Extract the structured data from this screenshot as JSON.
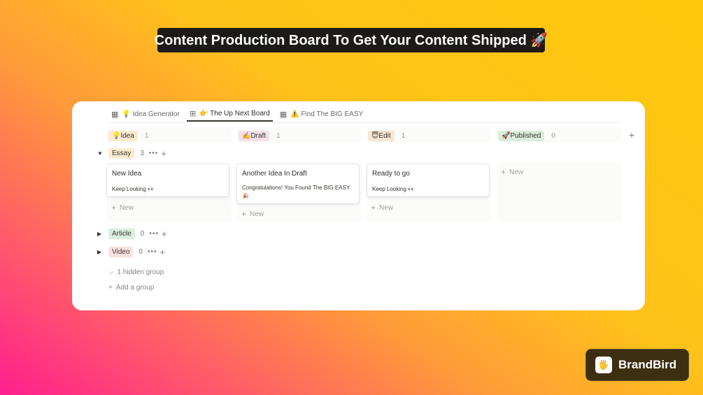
{
  "banner": {
    "title": "Content Production Board To Get Your Content Shipped 🚀"
  },
  "tabs": [
    {
      "icon": "▦",
      "label": "💡 Idea Generator"
    },
    {
      "icon": "⊞",
      "label": "👉 The Up Next Board"
    },
    {
      "icon": "▦",
      "label": "⚠️ Find The BIG EASY"
    }
  ],
  "columns": [
    {
      "label": "💡Idea",
      "count": "1"
    },
    {
      "label": "✍️Draft",
      "count": "1"
    },
    {
      "label": "😇Edit",
      "count": "1"
    },
    {
      "label": "🚀Published",
      "count": "0"
    }
  ],
  "groups": [
    {
      "label": "Essay",
      "count": "3",
      "caret": "▼"
    },
    {
      "label": "Article",
      "count": "0",
      "caret": "▶"
    },
    {
      "label": "Video",
      "count": "0",
      "caret": "▶"
    }
  ],
  "cards": [
    {
      "title": "New Idea",
      "sub": "Keep Looking 👀"
    },
    {
      "title": "Another Idea In Draft",
      "sub": "Congratulations! You Found The BIG EASY 🎉"
    },
    {
      "title": "Ready to go",
      "sub": "Keep Looking 👀"
    }
  ],
  "labels": {
    "new": "New",
    "dots": "•••",
    "plus": "+",
    "hidden_group": "1 hidden group",
    "add_group": "Add a group"
  },
  "brand": {
    "logo": "🖐",
    "name": "BrandBird"
  }
}
